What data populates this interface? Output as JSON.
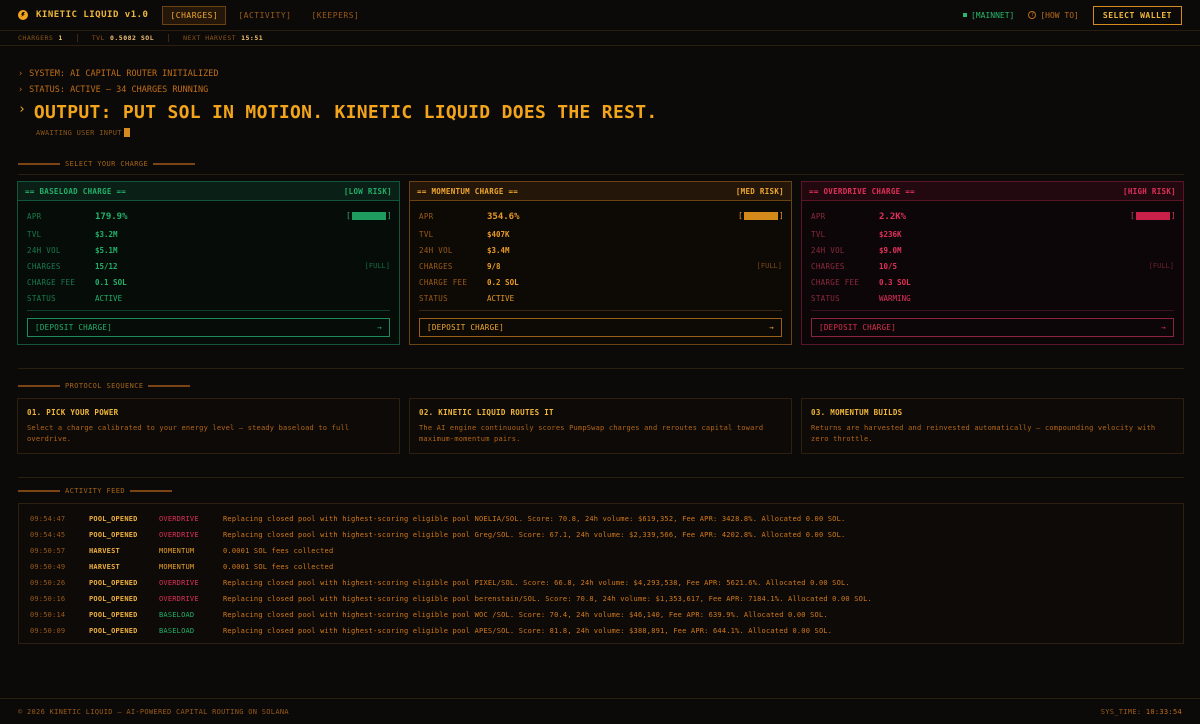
{
  "brand": {
    "name": "KINETIC LIQUID v1.0",
    "icon": "bolt-icon"
  },
  "nav": {
    "tabs": [
      {
        "label": "[CHARGES]",
        "active": true
      },
      {
        "label": "[ACTIVITY]",
        "active": false
      },
      {
        "label": "[KEEPERS]",
        "active": false
      }
    ],
    "network": "[MAINNET]",
    "howto": "[HOW TO]",
    "wallet": "SELECT WALLET"
  },
  "stats": {
    "chargers_label": "CHARGERS",
    "chargers_value": "1",
    "tvl_label": "TVL",
    "tvl_value": "0.5082 SOL",
    "harvest_label": "NEXT HARVEST",
    "harvest_value": "15:51"
  },
  "terminal": {
    "line1": "SYSTEM: AI CAPITAL ROUTER INITIALIZED",
    "line2": "STATUS: ACTIVE — 34 CHARGES RUNNING",
    "headline": "OUTPUT: PUT SOL IN MOTION. KINETIC LIQUID DOES THE REST.",
    "awaiting": "AWAITING USER INPUT"
  },
  "sections": {
    "select": "SELECT YOUR CHARGE",
    "protocol": "PROTOCOL SEQUENCE",
    "feed": "ACTIVITY FEED"
  },
  "colors": {
    "green": "#22b06a",
    "orange": "#f0a830",
    "red": "#e0305a",
    "background": "#0b0a09"
  },
  "cards": [
    {
      "title": "== BASELOAD CHARGE ==",
      "risk": "[LOW RISK]",
      "apr_label": "APR",
      "apr": "179.9%",
      "apr_meter": 0.9,
      "tvl_label": "TVL",
      "tvl": "$3.2M",
      "vol_label": "24H VOL",
      "vol": "$5.1M",
      "charges_label": "CHARGES",
      "charges": "15/12",
      "charges_tag": "[FULL]",
      "fee_label": "CHARGE FEE",
      "fee": "0.1 SOL",
      "status_label": "STATUS",
      "status": "ACTIVE",
      "deposit": "[DEPOSIT CHARGE]",
      "arrow": "→"
    },
    {
      "title": "== MOMENTUM CHARGE ==",
      "risk": "[MED RISK]",
      "apr_label": "APR",
      "apr": "354.6%",
      "apr_meter": 0.9,
      "tvl_label": "TVL",
      "tvl": "$407K",
      "vol_label": "24H VOL",
      "vol": "$3.4M",
      "charges_label": "CHARGES",
      "charges": "9/8",
      "charges_tag": "[FULL]",
      "fee_label": "CHARGE FEE",
      "fee": "0.2 SOL",
      "status_label": "STATUS",
      "status": "ACTIVE",
      "deposit": "[DEPOSIT CHARGE]",
      "arrow": "→"
    },
    {
      "title": "== OVERDRIVE CHARGE ==",
      "risk": "[HIGH RISK]",
      "apr_label": "APR",
      "apr": "2.2K%",
      "apr_meter": 0.9,
      "tvl_label": "TVL",
      "tvl": "$236K",
      "vol_label": "24H VOL",
      "vol": "$9.0M",
      "charges_label": "CHARGES",
      "charges": "10/5",
      "charges_tag": "[FULL]",
      "fee_label": "CHARGE FEE",
      "fee": "0.3 SOL",
      "status_label": "STATUS",
      "status": "WARMING",
      "deposit": "[DEPOSIT CHARGE]",
      "arrow": "→"
    }
  ],
  "steps": [
    {
      "title": "01. PICK YOUR POWER",
      "desc": "Select a charge calibrated to your energy level — steady baseload to full overdrive."
    },
    {
      "title": "02. KINETIC LIQUID ROUTES IT",
      "desc": "The AI engine continuously scores PumpSwap charges and reroutes capital toward maximum-momentum pairs."
    },
    {
      "title": "03. MOMENTUM BUILDS",
      "desc": "Returns are harvested and reinvested automatically — compounding velocity with zero throttle."
    }
  ],
  "feed": [
    {
      "time": "09:54:47",
      "type": "POOL_OPENED",
      "pool": "OVERDRIVE",
      "kind": "overdrive",
      "msg": "Replacing closed pool with highest-scoring eligible pool NOELIA/SOL. Score: 70.8, 24h volume: $619,352, Fee APR: 3428.8%. Allocated 0.00 SOL."
    },
    {
      "time": "09:54:45",
      "type": "POOL_OPENED",
      "pool": "OVERDRIVE",
      "kind": "overdrive",
      "msg": "Replacing closed pool with highest-scoring eligible pool Greg/SOL. Score: 67.1, 24h volume: $2,339,566, Fee APR: 4202.8%. Allocated 0.00 SOL."
    },
    {
      "time": "09:50:57",
      "type": "HARVEST",
      "pool": "MOMENTUM",
      "kind": "momentum",
      "msg": "0.0001 SOL fees collected"
    },
    {
      "time": "09:50:49",
      "type": "HARVEST",
      "pool": "MOMENTUM",
      "kind": "momentum",
      "msg": "0.0001 SOL fees collected"
    },
    {
      "time": "09:50:26",
      "type": "POOL_OPENED",
      "pool": "OVERDRIVE",
      "kind": "overdrive",
      "msg": "Replacing closed pool with highest-scoring eligible pool PIXEL/SOL. Score: 66.8, 24h volume: $4,293,538, Fee APR: 5621.6%. Allocated 0.00 SOL."
    },
    {
      "time": "09:50:16",
      "type": "POOL_OPENED",
      "pool": "OVERDRIVE",
      "kind": "overdrive",
      "msg": "Replacing closed pool with highest-scoring eligible pool berenstain/SOL. Score: 70.8, 24h volume: $1,353,617, Fee APR: 7184.1%. Allocated 0.00 SOL."
    },
    {
      "time": "09:50:14",
      "type": "POOL_OPENED",
      "pool": "BASELOAD",
      "kind": "baseload",
      "msg": "Replacing closed pool with highest-scoring eligible pool WOC /SOL. Score: 70.4, 24h volume: $46,140, Fee APR: 639.9%. Allocated 0.00 SOL."
    },
    {
      "time": "09:50:09",
      "type": "POOL_OPENED",
      "pool": "BASELOAD",
      "kind": "baseload",
      "msg": "Replacing closed pool with highest-scoring eligible pool APES/SOL. Score: 81.8, 24h volume: $388,891, Fee APR: 644.1%. Allocated 0.00 SOL."
    }
  ],
  "footer": {
    "copyright": "© 2026 KINETIC LIQUID — AI-POWERED CAPITAL ROUTING ON SOLANA",
    "systime_label": "SYS_TIME:",
    "systime": "10:33:54"
  }
}
